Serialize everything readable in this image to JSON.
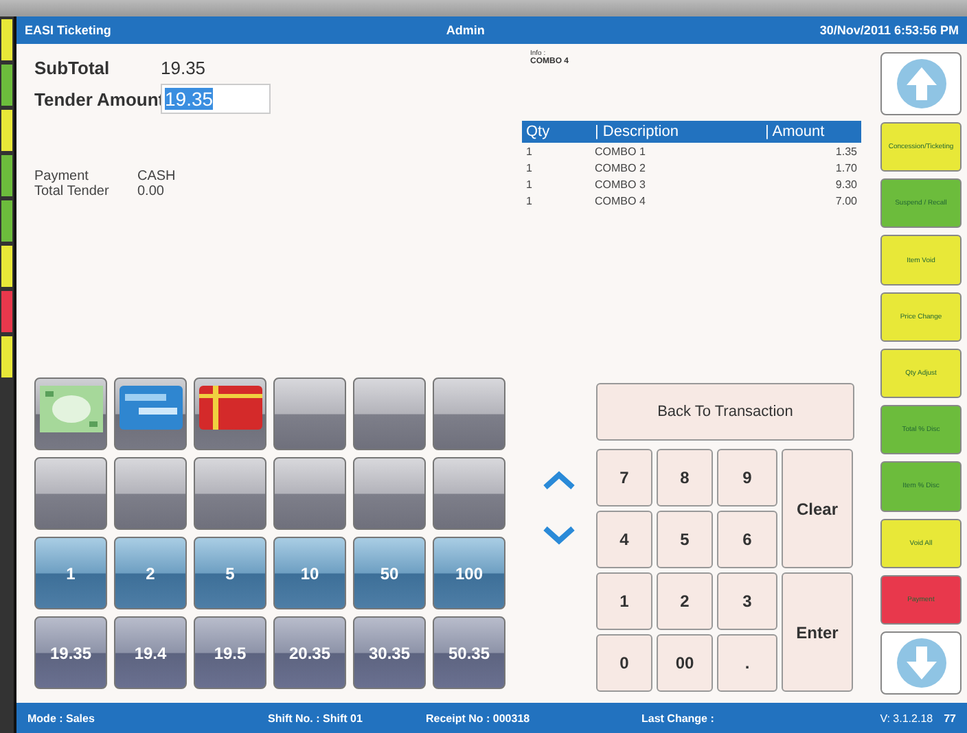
{
  "window": {
    "title": "EASI Ticketing",
    "user": "Admin",
    "datetime": "30/Nov/2011 6:53:56 PM"
  },
  "totals": {
    "subtotal_label": "SubTotal",
    "subtotal": "19.35",
    "tender_label": "Tender Amount",
    "tender_value": "19.35"
  },
  "payment_info": [
    {
      "label": "Payment",
      "value": "CASH"
    },
    {
      "label": "Total Tender",
      "value": "0.00"
    }
  ],
  "info": {
    "label": "Info :",
    "value": "COMBO 4"
  },
  "table": {
    "columns": [
      "Qty",
      "| Description",
      "| Amount"
    ],
    "rows": [
      {
        "qty": "1",
        "description": "COMBO 1",
        "amount": "1.35"
      },
      {
        "qty": "1",
        "description": "COMBO 2",
        "amount": "1.70"
      },
      {
        "qty": "1",
        "description": "COMBO 3",
        "amount": "9.30"
      },
      {
        "qty": "1",
        "description": "COMBO 4",
        "amount": "7.00"
      }
    ]
  },
  "tender_buttons": [
    {
      "kind": "cash"
    },
    {
      "kind": "amex"
    },
    {
      "kind": "gift"
    },
    {
      "kind": "blank"
    },
    {
      "kind": "blank"
    },
    {
      "kind": "blank"
    },
    {
      "kind": "blank"
    },
    {
      "kind": "blank"
    },
    {
      "kind": "blank"
    },
    {
      "kind": "blank"
    },
    {
      "kind": "blank"
    },
    {
      "kind": "blank"
    },
    {
      "kind": "amount",
      "label": "1"
    },
    {
      "kind": "amount",
      "label": "2"
    },
    {
      "kind": "amount",
      "label": "5"
    },
    {
      "kind": "amount",
      "label": "10"
    },
    {
      "kind": "amount",
      "label": "50"
    },
    {
      "kind": "amount",
      "label": "100"
    },
    {
      "kind": "exact",
      "label": "19.35"
    },
    {
      "kind": "exact",
      "label": "19.4"
    },
    {
      "kind": "exact",
      "label": "19.5"
    },
    {
      "kind": "exact",
      "label": "20.35"
    },
    {
      "kind": "exact",
      "label": "30.35"
    },
    {
      "kind": "exact",
      "label": "50.35"
    }
  ],
  "back_button": "Back To Transaction",
  "keypad": [
    {
      "label": "7",
      "kind": "key"
    },
    {
      "label": "8",
      "kind": "key"
    },
    {
      "label": "9",
      "kind": "key"
    },
    {
      "label": "Clear",
      "kind": "tall"
    },
    {
      "label": "4",
      "kind": "key"
    },
    {
      "label": "5",
      "kind": "key"
    },
    {
      "label": "6",
      "kind": "key"
    },
    {
      "label": "1",
      "kind": "key"
    },
    {
      "label": "2",
      "kind": "key"
    },
    {
      "label": "3",
      "kind": "key"
    },
    {
      "label": "Enter",
      "kind": "tall"
    },
    {
      "label": "0",
      "kind": "key"
    },
    {
      "label": "00",
      "kind": "key"
    },
    {
      "label": ".",
      "kind": "key"
    }
  ],
  "function_buttons": [
    {
      "label": "Concession/Ticketing",
      "color": "#e8e838"
    },
    {
      "label": "Suspend / Recall",
      "color": "#6cbc3c"
    },
    {
      "label": "Item Void",
      "color": "#e8e838"
    },
    {
      "label": "Price Change",
      "color": "#e8e838"
    },
    {
      "label": "Qty Adjust",
      "color": "#e8e838"
    },
    {
      "label": "Total % Disc",
      "color": "#6cbc3c"
    },
    {
      "label": "Item % Disc",
      "color": "#6cbc3c"
    },
    {
      "label": "Void All",
      "color": "#e8e838"
    },
    {
      "label": "Payment",
      "color": "#e8384c"
    }
  ],
  "status_bar": {
    "mode": "Mode : Sales",
    "shift": "Shift No. : Shift 01",
    "receipt": "Receipt No : 000318",
    "last_change": "Last Change :",
    "version": "V: 3.1.2.18",
    "extra": "77"
  }
}
